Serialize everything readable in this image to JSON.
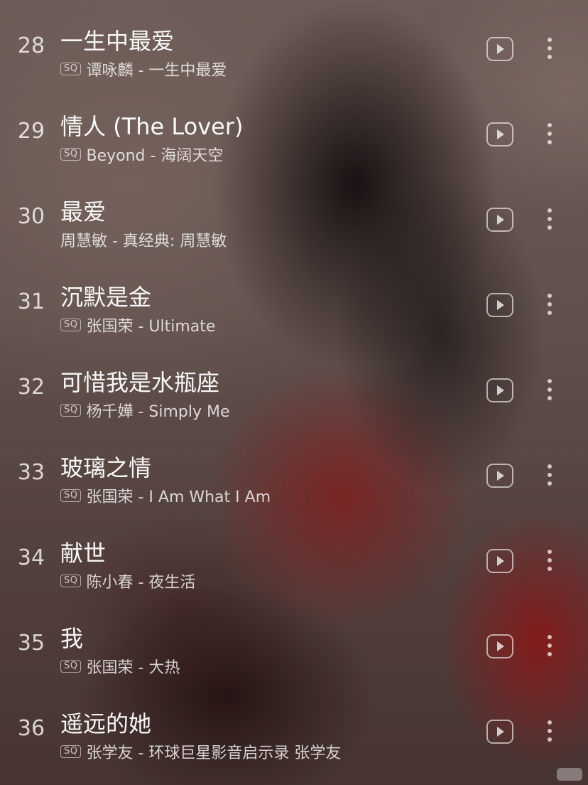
{
  "tracks": [
    {
      "number": "28",
      "title": "一生中最爱",
      "sq": "SQ",
      "subtitle": "谭咏麟 - 一生中最爱"
    },
    {
      "number": "29",
      "title": "情人 (The Lover)",
      "sq": "SQ",
      "subtitle": "Beyond - 海阔天空"
    },
    {
      "number": "30",
      "title": "最爱",
      "sq": "",
      "subtitle": "周慧敏 - 真经典: 周慧敏"
    },
    {
      "number": "31",
      "title": "沉默是金",
      "sq": "SQ",
      "subtitle": "张国荣 - Ultimate"
    },
    {
      "number": "32",
      "title": "可惜我是水瓶座",
      "sq": "SQ",
      "subtitle": "杨千嬅 - Simply Me"
    },
    {
      "number": "33",
      "title": "玻璃之情",
      "sq": "SQ",
      "subtitle": "张国荣 - I Am What I Am"
    },
    {
      "number": "34",
      "title": "献世",
      "sq": "SQ",
      "subtitle": "陈小春 - 夜生活"
    },
    {
      "number": "35",
      "title": "我",
      "sq": "SQ",
      "subtitle": "张国荣 - 大热"
    },
    {
      "number": "36",
      "title": "遥远的她",
      "sq": "SQ",
      "subtitle": "张学友 - 环球巨星影音启示录 张学友"
    }
  ],
  "icons": {
    "play": "play-video-icon",
    "more": "more-vertical-icon"
  },
  "colors": {
    "text_primary": "#ffffff",
    "accent_red": "#9b1a1c"
  }
}
